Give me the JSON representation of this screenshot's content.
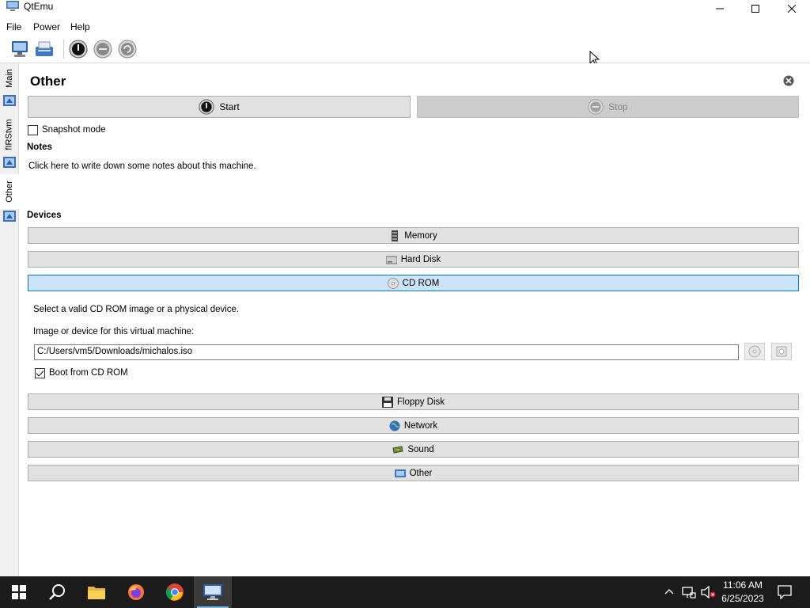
{
  "window": {
    "title": "QtEmu"
  },
  "menu": [
    "File",
    "Power",
    "Help"
  ],
  "toolbar": {
    "icons": [
      "new-machine-icon",
      "open-machine-icon",
      "power-icon",
      "pause-icon",
      "restart-icon"
    ]
  },
  "side_tabs": [
    {
      "label": "Main"
    },
    {
      "label": "fIRStvm"
    },
    {
      "label": "Other"
    }
  ],
  "page": {
    "title": "Other",
    "start_label": "Start",
    "stop_label": "Stop",
    "snapshot_label": "Snapshot mode",
    "snapshot_checked": false,
    "notes_heading": "Notes",
    "notes_text": "Click here to write down some notes about this machine.",
    "devices_heading": "Devices"
  },
  "devices": {
    "memory": "Memory",
    "hard_disk": "Hard Disk",
    "cd_rom": "CD ROM",
    "floppy": "Floppy Disk",
    "network": "Network",
    "sound": "Sound",
    "other": "Other"
  },
  "cdrom_panel": {
    "description": "Select a valid CD ROM image or a physical device.",
    "image_label": "Image or device for this virtual machine:",
    "image_path": "C:/Users/vm5/Downloads/michalos.iso",
    "boot_label": "Boot from CD ROM",
    "boot_checked": true
  },
  "taskbar": {
    "apps": [
      "start-icon",
      "search-icon",
      "file-explorer-icon",
      "firefox-icon",
      "chrome-icon",
      "qtemu-icon"
    ],
    "time": "11:06 AM",
    "date": "6/25/2023"
  },
  "colors": {
    "accent": "#0078d7",
    "active_device_bg": "#cce4f7",
    "button_bg": "#e1e1e1",
    "taskbar_bg": "#1b1b1b"
  }
}
